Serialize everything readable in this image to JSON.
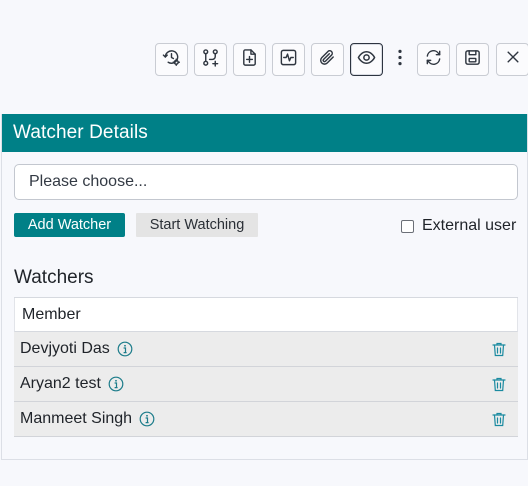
{
  "toolbar": {
    "icons": [
      "history-settings-icon",
      "workflow-add-icon",
      "file-add-icon",
      "activity-icon",
      "attachment-icon",
      "eye-icon",
      "more-vertical-icon",
      "refresh-icon",
      "save-icon",
      "close-icon"
    ]
  },
  "panel": {
    "title": "Watcher Details",
    "choose_placeholder": "Please choose...",
    "add_watcher_label": "Add Watcher",
    "start_watching_label": "Start Watching",
    "external_user_label": "External user",
    "external_user_checked": false
  },
  "watchers": {
    "title": "Watchers",
    "column_header": "Member",
    "rows": [
      {
        "name": "Devjyoti Das"
      },
      {
        "name": "Aryan2 test"
      },
      {
        "name": "Manmeet Singh"
      }
    ]
  },
  "colors": {
    "accent": "#008087",
    "row_bg": "#ececec",
    "icon": "#2f3640",
    "info": "#1c7c8a"
  }
}
